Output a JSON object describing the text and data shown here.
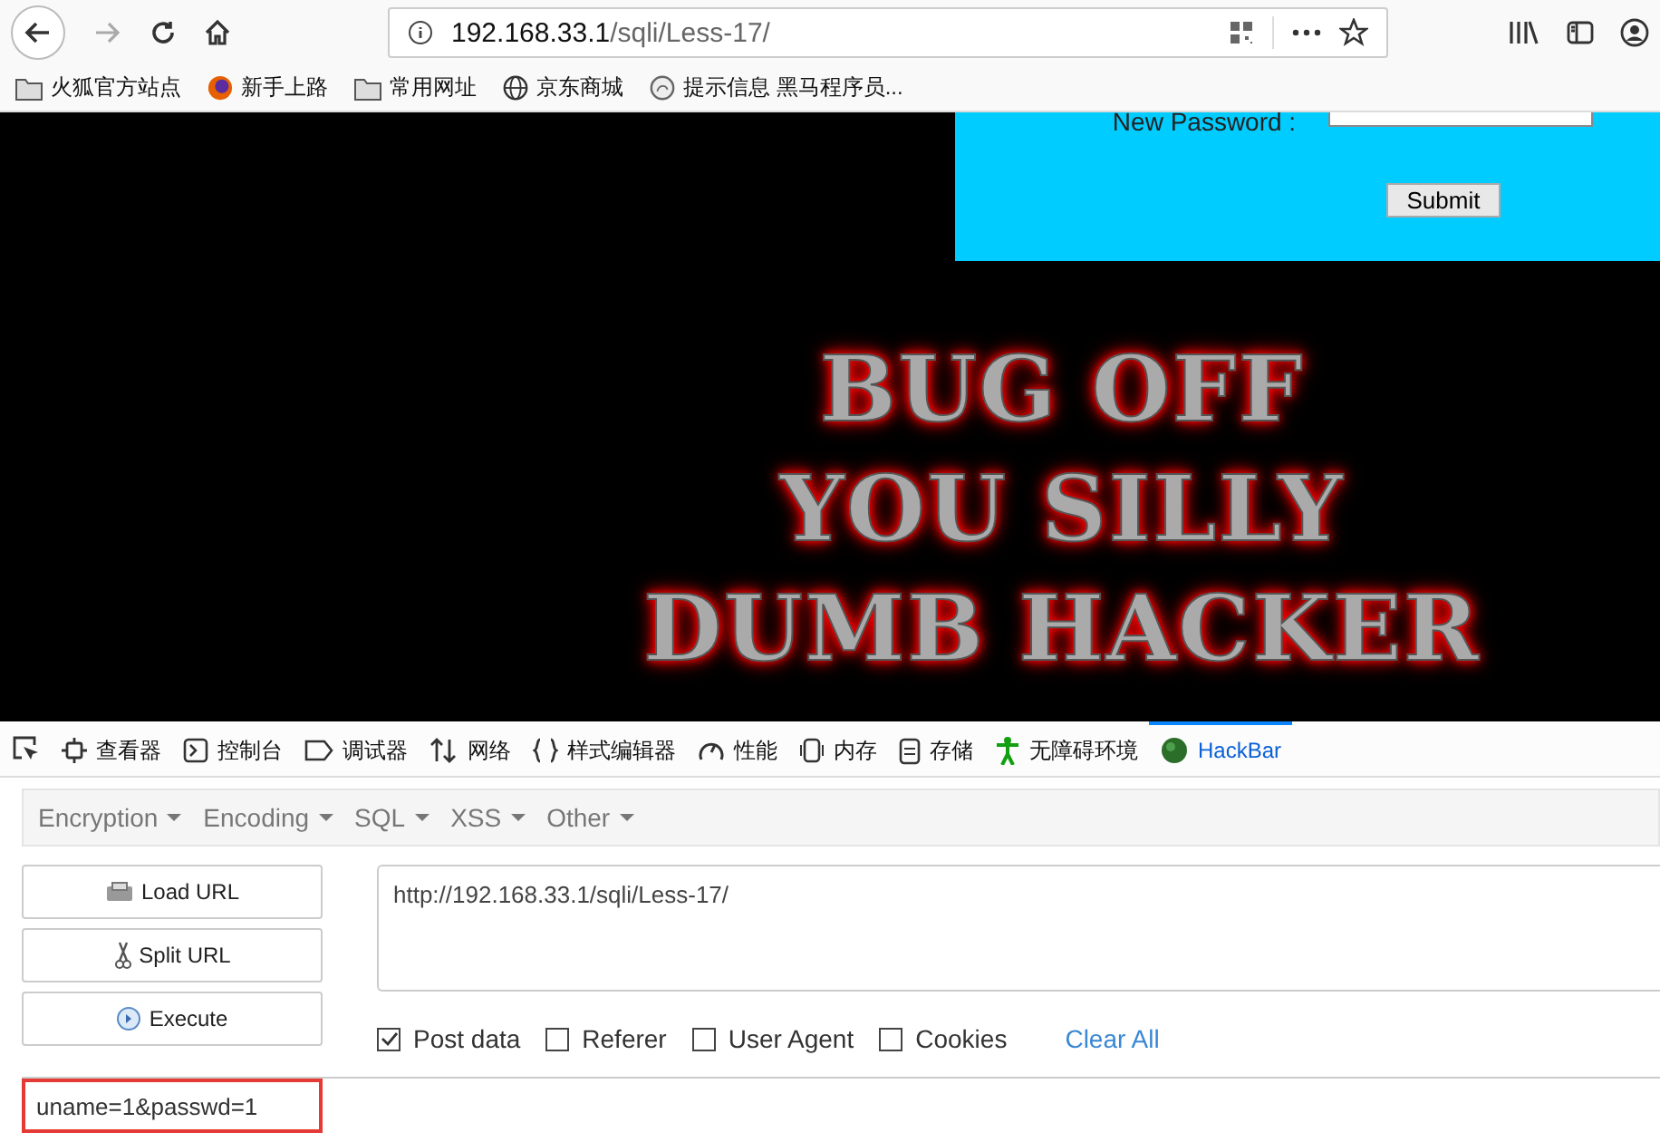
{
  "browser": {
    "url_host": "192.168.33.1",
    "url_path": "/sqli/Less-17/",
    "bookmarks": [
      {
        "kind": "folder",
        "label": "火狐官方站点"
      },
      {
        "kind": "firefox",
        "label": "新手上路"
      },
      {
        "kind": "folder",
        "label": "常用网址"
      },
      {
        "kind": "globe",
        "label": "京东商城"
      },
      {
        "kind": "swirl",
        "label": "提示信息 黑马程序员..."
      }
    ]
  },
  "page": {
    "form": {
      "label": "New Password :",
      "button": "Submit"
    },
    "banner_lines": [
      "BUG OFF",
      "YOU SILLY",
      "DUMB HACKER"
    ]
  },
  "devtools": {
    "tabs": [
      {
        "kind": "viewer",
        "label": "查看器",
        "selected": false
      },
      {
        "kind": "console",
        "label": "控制台",
        "selected": false
      },
      {
        "kind": "debugger",
        "label": "调试器",
        "selected": false
      },
      {
        "kind": "network",
        "label": "网络",
        "selected": false
      },
      {
        "kind": "style",
        "label": "样式编辑器",
        "selected": false
      },
      {
        "kind": "perf",
        "label": "性能",
        "selected": false
      },
      {
        "kind": "memory",
        "label": "内存",
        "selected": false
      },
      {
        "kind": "storage",
        "label": "存储",
        "selected": false
      },
      {
        "kind": "access",
        "label": "无障碍环境",
        "selected": false
      },
      {
        "kind": "hackbar",
        "label": "HackBar",
        "selected": true
      }
    ]
  },
  "hackbar": {
    "menus": [
      "Encryption",
      "Encoding",
      "SQL",
      "XSS",
      "Other"
    ],
    "buttons": [
      {
        "kind": "load",
        "label": "Load URL"
      },
      {
        "kind": "split",
        "label": "Split URL"
      },
      {
        "kind": "execute",
        "label": "Execute"
      }
    ],
    "url": "http://192.168.33.1/sqli/Less-17/",
    "options": [
      {
        "label": "Post data",
        "checked": true
      },
      {
        "label": "Referer",
        "checked": false
      },
      {
        "label": "User Agent",
        "checked": false
      },
      {
        "label": "Cookies",
        "checked": false
      }
    ],
    "clear_all": "Clear All",
    "post_data": "uname=1&passwd=1"
  }
}
